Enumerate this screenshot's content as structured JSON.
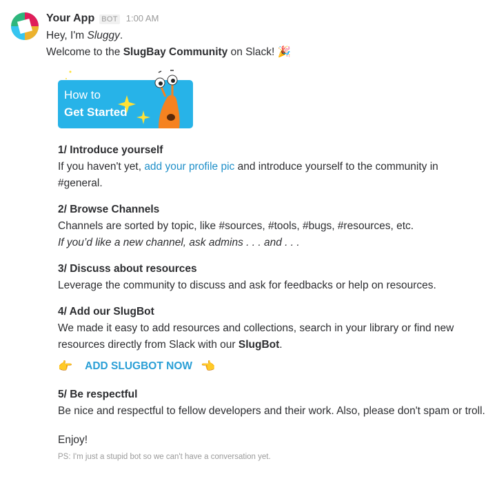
{
  "message": {
    "app_name": "Your App",
    "bot_tag": "BOT",
    "time": "1:00 AM",
    "greeting_prefix": "Hey, I'm ",
    "greeting_name": "Sluggy",
    "greeting_suffix": ".",
    "welcome_prefix": "Welcome to the ",
    "welcome_bold": "SlugBay Community",
    "welcome_suffix": " on Slack! ",
    "party_emoji": "🎉"
  },
  "banner": {
    "line1": "How to",
    "line2": "Get Started"
  },
  "sections": [
    {
      "title": "1/ Introduce yourself",
      "body_prefix": "If you haven't yet, ",
      "link": "add your profile pic",
      "body_suffix": " and introduce yourself to the community in #general."
    },
    {
      "title": "2/ Browse Channels",
      "body": "Channels are sorted by topic, like #sources, #tools, #bugs, #resources, etc.",
      "note": "If you’d like a new channel, ask admins  . . .  and  . . ."
    },
    {
      "title": "3/ Discuss about resources",
      "body": "Leverage the community to discuss and ask for feedbacks or help on resources."
    },
    {
      "title": "4/ Add our SlugBot",
      "body_prefix": "We made it easy to add resources and collections, search in your library or find new resources directly from Slack with our ",
      "body_bold": "SlugBot",
      "body_suffix": "."
    },
    {
      "title": "5/ Be respectful",
      "body": "Be nice and respectful to fellow developers and their work. Also, please don't spam or troll."
    }
  ],
  "cta": {
    "left_hand": "👉",
    "label": "ADD SLUGBOT NOW",
    "right_hand": "👈"
  },
  "footer": {
    "enjoy": "Enjoy!",
    "ps": "PS: I'm just a stupid bot so we can't have a conversation yet."
  },
  "colors": {
    "link": "#1e8fc9",
    "banner": "#27b3e8",
    "slug": "#f58220"
  }
}
